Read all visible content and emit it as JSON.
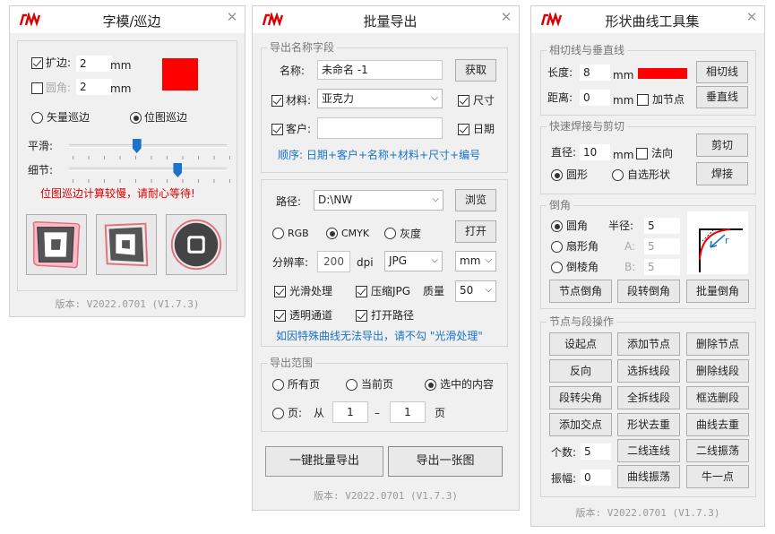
{
  "colors": {
    "accent": "#1a73c8",
    "red": "#ff0000",
    "warn": "#e00000"
  },
  "win1": {
    "title": "字模/巡边",
    "expand_label": "扩边:",
    "expand_value": "2",
    "expand_unit": "mm",
    "round_label": "圆角:",
    "round_value": "2",
    "round_unit": "mm",
    "vector_label": "矢量巡边",
    "bitmap_label": "位图巡边",
    "smooth_label": "平滑:",
    "detail_label": "细节:",
    "smooth_level": 0.43,
    "detail_level": 0.69,
    "warning": "位图巡边计算较慢，请耐心等待!",
    "version": "版本: V2022.0701 (V1.7.3)"
  },
  "win2": {
    "title": "批量导出",
    "group_name": "导出名称字段",
    "name_label": "名称:",
    "name_value": "未命名 -1",
    "fetch_btn": "获取",
    "material_label": "材料:",
    "material_value": "亚克力",
    "size_label": "尺寸",
    "customer_label": "客户:",
    "customer_value": "",
    "date_label": "日期",
    "order_text": "顺序: 日期+客户+名称+材料+尺寸+编号",
    "path_label": "路径:",
    "path_value": "D:\\NW",
    "browse_btn": "浏览",
    "rgb_label": "RGB",
    "cmyk_label": "CMYK",
    "gray_label": "灰度",
    "open_btn": "打开",
    "res_label": "分辨率:",
    "res_value": "200",
    "dpi_label": "dpi",
    "format_value": "JPG",
    "unit_value": "mm",
    "smooth_label": "光滑处理",
    "compress_label": "压缩JPG",
    "quality_label": "质量",
    "quality_value": "50",
    "transparent_label": "透明通道",
    "openpath_label": "打开路径",
    "note": "如因特殊曲线无法导出，请不勾 \"光滑处理\"",
    "group_range": "导出范围",
    "all_pages": "所有页",
    "current_page": "当前页",
    "selected": "选中的内容",
    "pages_label": "页:",
    "from_label": "从",
    "from_value": "1",
    "dash": "–",
    "to_value": "1",
    "page_suffix": "页",
    "batch_btn": "一键批量导出",
    "single_btn": "导出一张图",
    "version": "版本: V2022.0701 (V1.7.3)"
  },
  "win3": {
    "title": "形状曲线工具集",
    "group_tangent": "相切线与垂直线",
    "length_label": "长度:",
    "length_value": "8",
    "length_unit": "mm",
    "tangent_btn": "相切线",
    "distance_label": "距离:",
    "distance_value": "0",
    "distance_unit": "mm",
    "addnode_label": "加节点",
    "vertical_btn": "垂直线",
    "group_weld": "快速焊接与剪切",
    "diameter_label": "直径:",
    "diameter_value": "10",
    "diameter_unit": "mm",
    "normal_label": "法向",
    "cut_btn": "剪切",
    "circle_label": "圆形",
    "custom_label": "自选形状",
    "weld_btn": "焊接",
    "group_corner": "倒角",
    "round_label": "圆角",
    "radius_label": "半径:",
    "radius_value": "5",
    "fan_label": "扇形角",
    "a_label": "A:",
    "a_value": "5",
    "bevel_label": "倒棱角",
    "b_label": "B:",
    "b_value": "5",
    "corner_preview_label": "r",
    "node_corner_btn": "节点倒角",
    "seg_corner_btn": "段转倒角",
    "batch_corner_btn": "批量倒角",
    "group_node": "节点与段操作",
    "grid": [
      [
        "设起点",
        "添加节点",
        "删除节点"
      ],
      [
        "反向",
        "选拆线段",
        "删除线段"
      ],
      [
        "段转尖角",
        "全拆线段",
        "框选删段"
      ],
      [
        "添加交点",
        "形状去重",
        "曲线去重"
      ]
    ],
    "count_label": "个数:",
    "count_value": "5",
    "two_connect_btn": "二线连线",
    "two_shake_btn": "二线振荡",
    "amp_label": "振幅:",
    "amp_value": "0",
    "curve_shake_btn": "曲线振荡",
    "oxbow_btn": "牛一点",
    "version": "版本: V2022.0701 (V1.7.3)"
  }
}
